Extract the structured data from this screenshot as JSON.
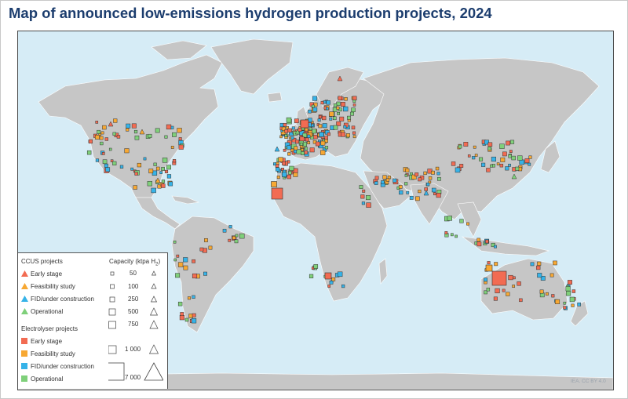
{
  "title": "Map of announced low-emissions hydrogen production projects, 2024",
  "credit": "IEA. CC BY 4.0",
  "colors": {
    "ocean": "#d6ecf6",
    "land": "#c6c6c6",
    "early_stage": "#f26b52",
    "feasibility_study": "#f7a833",
    "fid_under_construction": "#36b3e8",
    "operational": "#7fd07a"
  },
  "legend": {
    "ccus_heading": "CCUS projects",
    "electrolyser_heading": "Electrolyser projects",
    "capacity_heading": "Capacity (ktpa H",
    "capacity_sub": "2",
    "capacity_close": ")",
    "ccus_items": [
      {
        "label": "Early stage",
        "color_key": "early_stage",
        "shape": "triangle-icon"
      },
      {
        "label": "Feasibility study",
        "color_key": "feasibility_study",
        "shape": "triangle-icon"
      },
      {
        "label": "FID/under construction",
        "color_key": "fid_under_construction",
        "shape": "triangle-icon"
      },
      {
        "label": "Operational",
        "color_key": "operational",
        "shape": "triangle-icon"
      }
    ],
    "electrolyser_items": [
      {
        "label": "Early stage",
        "color_key": "early_stage",
        "shape": "square-icon"
      },
      {
        "label": "Feasibility study",
        "color_key": "feasibility_study",
        "shape": "square-icon"
      },
      {
        "label": "FID/under construction",
        "color_key": "fid_under_construction",
        "shape": "square-icon"
      },
      {
        "label": "Operational",
        "color_key": "operational",
        "shape": "square-icon"
      }
    ],
    "capacities": [
      "50",
      "100",
      "250",
      "500",
      "750",
      "1 000",
      "7 000"
    ]
  }
}
